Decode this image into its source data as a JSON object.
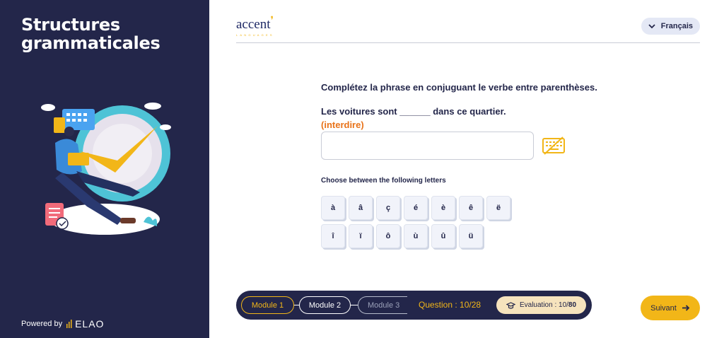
{
  "sidebar": {
    "title": "Structures grammaticales",
    "powered_by": "Powered by",
    "brand": "ELAO"
  },
  "header": {
    "logo": "accent",
    "logo_sub": "LANGUAGES",
    "language": "Français"
  },
  "question": {
    "instruction": "Complétez la phrase en conjuguant le verbe entre parenthèses.",
    "sentence": "Les voitures sont ______ dans ce quartier.",
    "hint": "(interdire)",
    "answer_value": "",
    "choose_label": "Choose between the following letters",
    "letters": [
      "à",
      "â",
      "ç",
      "é",
      "è",
      "ê",
      "ë",
      "î",
      "ï",
      "ô",
      "ù",
      "û",
      "ü"
    ]
  },
  "progress": {
    "module1": "Module 1",
    "module2": "Module 2",
    "module3": "Module 3",
    "question_count": "Question : 10/28",
    "evaluation_label": "Evaluation : 10/",
    "evaluation_total": "80"
  },
  "footer": {
    "next_label": "Suivant"
  },
  "colors": {
    "navy": "#23264a",
    "accent_yellow": "#f2b618",
    "hint_orange": "#e8731a"
  }
}
